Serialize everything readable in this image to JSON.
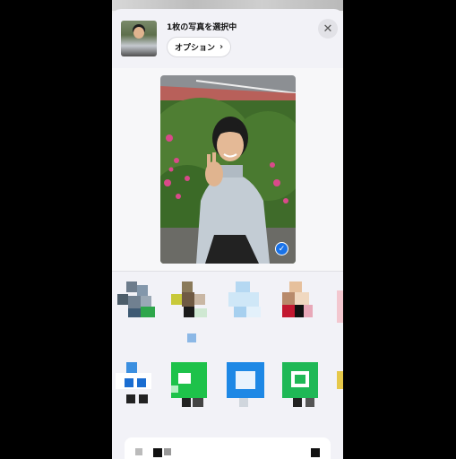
{
  "share_sheet": {
    "title": "1枚の写真を選択中",
    "options_label": "オプション",
    "options_chevron": "›",
    "close_glyph": "✕",
    "check_glyph": "✓"
  },
  "icons": {
    "close": "close-icon",
    "chevron": "chevron-right-icon",
    "selected": "checkmark-icon"
  },
  "colors": {
    "accent": "#1a73e8",
    "sheet_bg": "#f2f2f7"
  },
  "contacts_row": [
    {
      "name": "contact-1"
    },
    {
      "name": "contact-2"
    },
    {
      "name": "contact-3"
    },
    {
      "name": "contact-4"
    }
  ],
  "apps_row": [
    {
      "name": "app-1"
    },
    {
      "name": "app-2"
    },
    {
      "name": "app-3"
    },
    {
      "name": "app-4"
    }
  ]
}
